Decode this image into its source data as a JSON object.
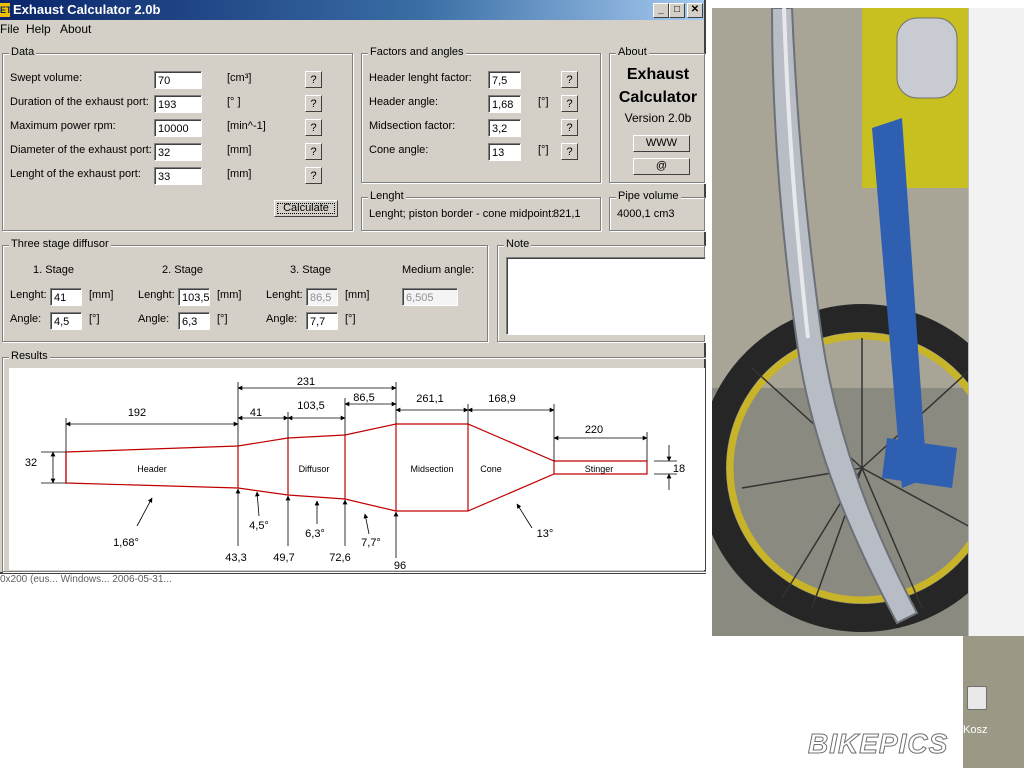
{
  "window": {
    "title": "Exhaust Calculator 2.0b",
    "icon_label": "ET",
    "minimize": "_",
    "maximize": "□",
    "close": "✕"
  },
  "menu": [
    "File",
    "Help",
    "About"
  ],
  "data_group": {
    "title": "Data",
    "rows": [
      {
        "label": "Swept volume:",
        "value": "70",
        "unit": "[cm³]"
      },
      {
        "label": "Duration of the exhaust port:",
        "value": "193",
        "unit": "[° ]"
      },
      {
        "label": "Maximum power rpm:",
        "value": "10000",
        "unit": "[min^-1]"
      },
      {
        "label": "Diameter of the exhaust port:",
        "value": "32",
        "unit": "[mm]"
      },
      {
        "label": "Lenght of the exhaust port:",
        "value": "33",
        "unit": "[mm]"
      }
    ],
    "help": "?",
    "calculate": "Calculate"
  },
  "factors_group": {
    "title": "Factors and angles",
    "rows": [
      {
        "label": "Header lenght factor:",
        "value": "7,5",
        "unit": ""
      },
      {
        "label": "Header angle:",
        "value": "1,68",
        "unit": "[°]"
      },
      {
        "label": "Midsection factor:",
        "value": "3,2",
        "unit": ""
      },
      {
        "label": "Cone angle:",
        "value": "13",
        "unit": "[°]"
      }
    ]
  },
  "about_group": {
    "title": "About",
    "line1": "Exhaust",
    "line2": "Calculator",
    "version": "Version 2.0b",
    "www": "WWW",
    "email": "@"
  },
  "length_group": {
    "title": "Lenght",
    "text": "Lenght; piston border - cone midpoint:",
    "value": "821,1"
  },
  "pipe_group": {
    "title": "Pipe volume",
    "value": "4000,1 cm3"
  },
  "diffusor_group": {
    "title": "Three stage diffusor",
    "stage1": {
      "title": "1. Stage",
      "length": "41",
      "angle": "4,5"
    },
    "stage2": {
      "title": "2. Stage",
      "length": "103,5",
      "angle": "6,3"
    },
    "stage3": {
      "title": "3. Stage",
      "length": "86,5",
      "angle": "7,7"
    },
    "medium_label": "Medium angle:",
    "medium_value": "6,505",
    "length_label": "Lenght:",
    "angle_label": "Angle:",
    "mm": "[mm]",
    "deg": "[°]"
  },
  "note_group": {
    "title": "Note"
  },
  "results_group": {
    "title": "Results"
  },
  "diagram": {
    "dims_top": {
      "d231": "231",
      "d192": "192",
      "d41": "41",
      "d1035": "103,5",
      "d865": "86,5",
      "d2611": "261,1",
      "d1689": "168,9",
      "d220": "220"
    },
    "diam_left": "32",
    "diam_right": "18",
    "sections": {
      "header": "Header",
      "diffusor": "Diffusor",
      "midsection": "Midsection",
      "cone": "Cone",
      "stinger": "Stinger"
    },
    "angles": {
      "a168": "1,68°",
      "a45": "4,5°",
      "a63": "6,3°",
      "a77": "7,7°",
      "a13": "13°"
    },
    "diameters_bottom": {
      "b433": "43,3",
      "b497": "49,7",
      "b726": "72,6",
      "b96": "96"
    }
  },
  "desktop": {
    "bg_text": "0x200 (eus... Windows... 2006-05-31...",
    "recycle_label": "Kosz",
    "watermark": "BIKEPICS"
  },
  "colors": {
    "accent": "#0a246a",
    "pipe": "#c00000",
    "window": "#d4d0c8"
  }
}
